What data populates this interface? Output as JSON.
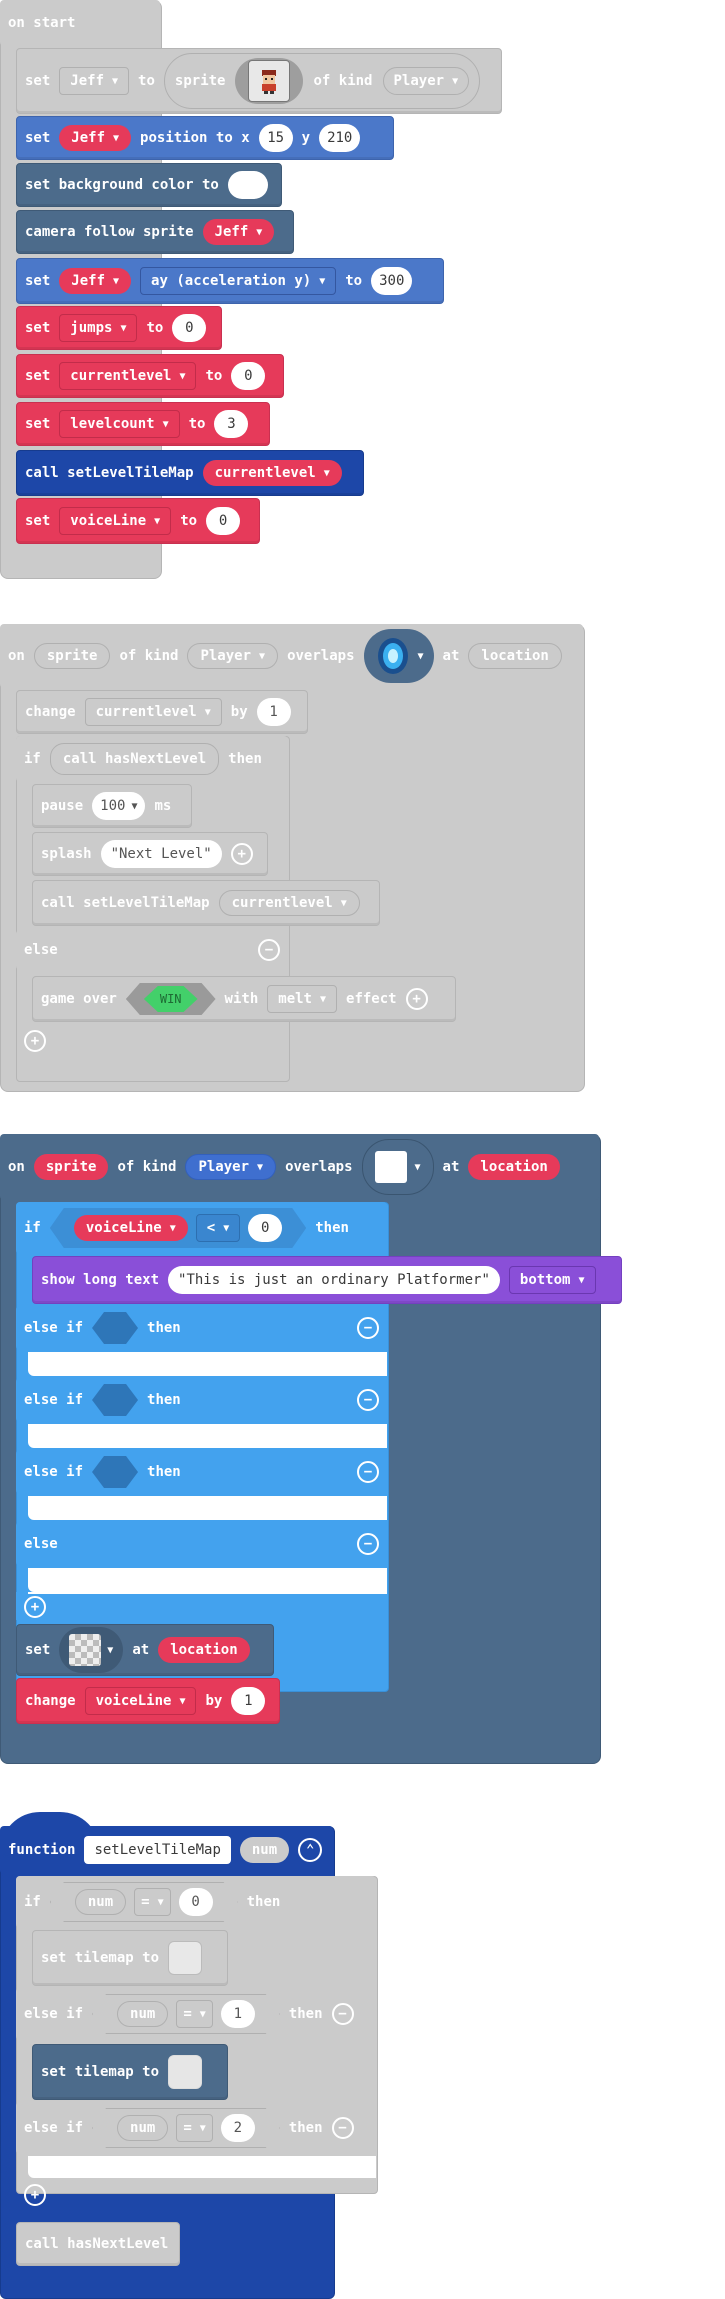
{
  "colors": {
    "grey": "#cbcbcb",
    "sprites_blue": "#4b78c9",
    "scene_slate": "#4c6b8b",
    "variables_red": "#e63a5a",
    "functions_navy": "#1d47a8",
    "logic_sky": "#43a2ee",
    "game_purple": "#8a4fd8",
    "win_green": "#43d06a"
  },
  "on_start": {
    "header": "on start",
    "set_sprite": {
      "set": "set",
      "var": "Jeff",
      "to": "to",
      "sprite": "sprite",
      "of_kind": "of kind",
      "kind": "Player"
    },
    "position": {
      "set": "set",
      "var": "Jeff",
      "label": "position to x",
      "x": "15",
      "y_label": "y",
      "y": "210"
    },
    "background": {
      "label": "set background color to"
    },
    "camera": {
      "label": "camera follow sprite",
      "var": "Jeff"
    },
    "accel": {
      "set": "set",
      "var": "Jeff",
      "prop": "ay (acceleration y)",
      "to": "to",
      "value": "300"
    },
    "jumps": {
      "set": "set",
      "var": "jumps",
      "to": "to",
      "value": "0"
    },
    "currentlevel": {
      "set": "set",
      "var": "currentlevel",
      "to": "to",
      "value": "0"
    },
    "levelcount": {
      "set": "set",
      "var": "levelcount",
      "to": "to",
      "value": "3"
    },
    "call": {
      "label": "call setLevelTileMap",
      "arg": "currentlevel"
    },
    "voiceline": {
      "set": "set",
      "var": "voiceLine",
      "to": "to",
      "value": "0"
    }
  },
  "overlap1": {
    "on": "on",
    "sprite": "sprite",
    "of_kind": "of kind",
    "kind": "Player",
    "overlaps": "overlaps",
    "at": "at",
    "location": "location",
    "change": {
      "label": "change",
      "var": "currentlevel",
      "by": "by",
      "value": "1"
    },
    "if": {
      "label": "if",
      "cond": "call hasNextLevel",
      "then": "then"
    },
    "pause": {
      "label": "pause",
      "value": "100",
      "ms": "ms"
    },
    "splash": {
      "label": "splash",
      "text": "\"Next Level\""
    },
    "call": {
      "label": "call setLevelTileMap",
      "arg": "currentlevel"
    },
    "else": "else",
    "gameover": {
      "label": "game over",
      "win": "WIN",
      "with": "with",
      "effect_name": "melt",
      "effect": "effect"
    }
  },
  "overlap2": {
    "on": "on",
    "sprite": "sprite",
    "of_kind": "of kind",
    "kind": "Player",
    "overlaps": "overlaps",
    "at": "at",
    "location": "location",
    "if": {
      "label": "if",
      "var": "voiceLine",
      "op": "<",
      "value": "0",
      "then": "then"
    },
    "show": {
      "label": "show long text",
      "text": "\"This is just an ordinary Platformer\"",
      "pos": "bottom"
    },
    "elseif1": {
      "label": "else if",
      "then": "then"
    },
    "elseif2": {
      "label": "else if",
      "then": "then"
    },
    "elseif3": {
      "label": "else if",
      "then": "then"
    },
    "else": "else",
    "set": {
      "label": "set",
      "at": "at",
      "location": "location"
    },
    "change": {
      "label": "change",
      "var": "voiceLine",
      "by": "by",
      "value": "1"
    }
  },
  "function": {
    "label": "function",
    "name": "setLevelTileMap",
    "param": "num",
    "if": {
      "label": "if",
      "var": "num",
      "op": "=",
      "value": "0",
      "then": "then"
    },
    "set1": {
      "label": "set tilemap to"
    },
    "elseif1": {
      "label": "else if",
      "var": "num",
      "op": "=",
      "value": "1",
      "then": "then"
    },
    "set2": {
      "label": "set tilemap to"
    },
    "elseif2": {
      "label": "else if",
      "var": "num",
      "op": "=",
      "value": "2",
      "then": "then"
    },
    "call": {
      "label": "call hasNextLevel"
    }
  }
}
